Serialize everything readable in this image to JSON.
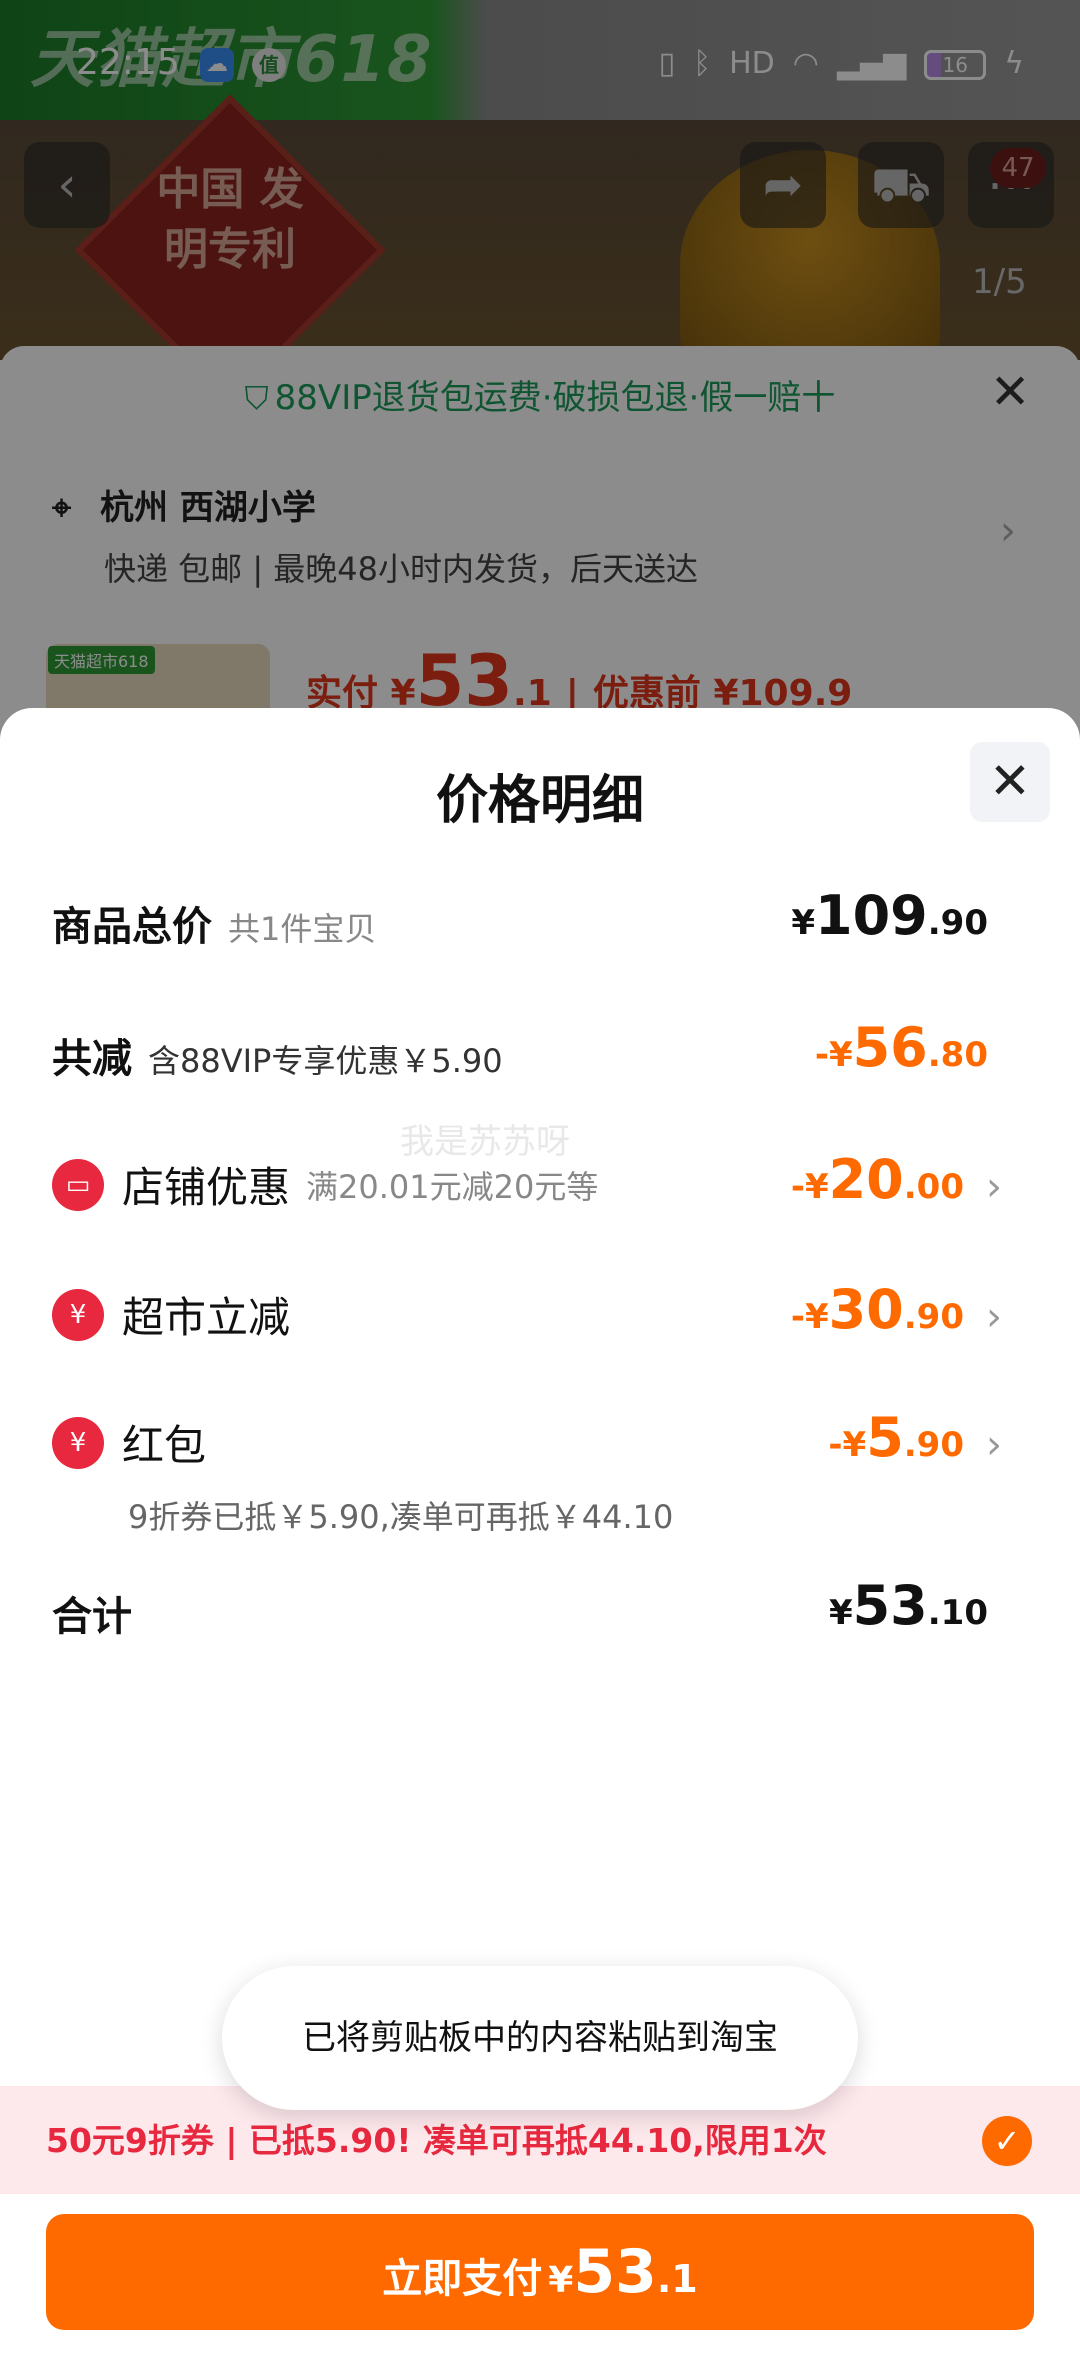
{
  "status_bar": {
    "time": "22:15",
    "battery": "16"
  },
  "background_page": {
    "banner_text": "天猫超市618",
    "seal_text": "中国 发明专利",
    "badge_count": "47",
    "image_counter": "1/5",
    "guarantee": "88VIP退货包运费·破损包退·假一赔十",
    "address": "杭州 西湖小学",
    "delivery": "快递 包邮 | 最晚48小时内发货，后天送达",
    "thumb_tag": "天猫超市618",
    "price_prefix": "实付 ¥",
    "price_big": "53",
    "price_small": ".1",
    "price_before": "优惠前 ¥109.9"
  },
  "modal": {
    "title": "价格明细",
    "watermark": "我是苏苏呀",
    "total_goods": {
      "label": "商品总价",
      "sub": "共1件宝贝",
      "cur": "¥",
      "int": "109",
      "dec": ".90"
    },
    "total_discount": {
      "label": "共减",
      "sub": "含88VIP专享优惠￥5.90",
      "cur": "-¥",
      "int": "56",
      "dec": ".80"
    },
    "store_discount": {
      "label": "店铺优惠",
      "sub": "满20.01元减20元等",
      "cur": "-¥",
      "int": "20",
      "dec": ".00"
    },
    "market_discount": {
      "label": "超市立减",
      "cur": "-¥",
      "int": "30",
      "dec": ".90"
    },
    "red_packet": {
      "label": "红包",
      "note": "9折券已抵￥5.90,凑单可再抵￥44.10",
      "cur": "-¥",
      "int": "5",
      "dec": ".90"
    },
    "sum": {
      "label": "合计",
      "cur": "¥",
      "int": "53",
      "dec": ".10"
    }
  },
  "toast": "已将剪贴板中的内容粘贴到淘宝",
  "coupon_bar": "50元9折券 | 已抵5.90! 凑单可再抵44.10,限用1次",
  "pay_button": {
    "label": "立即支付",
    "cur": "¥",
    "int": "53",
    "dec": ".1"
  },
  "colors": {
    "accent_orange": "#ff6a00",
    "discount_red": "#e8283e",
    "guarantee_green": "#1c9b5a"
  }
}
